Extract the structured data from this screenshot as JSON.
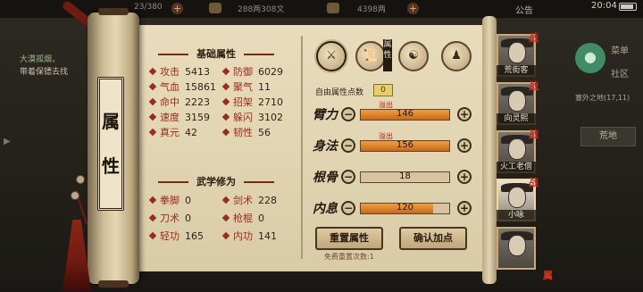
{
  "topbar": {
    "stamina": "23/380",
    "currency": "288两308文",
    "gold": "4398两",
    "notice": "公告",
    "time": "20:04"
  },
  "quest": {
    "line1": "大漠孤烟，",
    "line2": "带着保镖去找"
  },
  "side_right": {
    "menu": "菜单",
    "community": "社区",
    "location": "塞外之地(17,11)",
    "area": "荒地"
  },
  "scroll": {
    "title": "属性"
  },
  "base_attrs": {
    "title": "基础属性",
    "items": [
      {
        "label": "攻击",
        "value": "5413"
      },
      {
        "label": "防御",
        "value": "6029"
      },
      {
        "label": "气血",
        "value": "15861"
      },
      {
        "label": "聚气",
        "value": "11"
      },
      {
        "label": "命中",
        "value": "2223"
      },
      {
        "label": "招架",
        "value": "2710"
      },
      {
        "label": "速度",
        "value": "3159"
      },
      {
        "label": "躲闪",
        "value": "3102"
      },
      {
        "label": "真元",
        "value": "42"
      },
      {
        "label": "韧性",
        "value": "56"
      }
    ]
  },
  "martial_attrs": {
    "title": "武学修为",
    "items": [
      {
        "label": "拳脚",
        "value": "0"
      },
      {
        "label": "剑术",
        "value": "228"
      },
      {
        "label": "刀术",
        "value": "0"
      },
      {
        "label": "枪棍",
        "value": "0"
      },
      {
        "label": "轻功",
        "value": "165"
      },
      {
        "label": "内功",
        "value": "141"
      }
    ]
  },
  "tabs": {
    "active_mark": "属性"
  },
  "free_points": {
    "label": "自由属性点数",
    "value": "0"
  },
  "allocations": [
    {
      "name": "臂力",
      "value": "146",
      "overflow": "溢出",
      "fill": 1.0
    },
    {
      "name": "身法",
      "value": "156",
      "overflow": "溢出",
      "fill": 1.0
    },
    {
      "name": "根骨",
      "value": "18",
      "overflow": "",
      "fill": 0.0
    },
    {
      "name": "内息",
      "value": "120",
      "overflow": "",
      "fill": 0.82
    }
  ],
  "buttons": {
    "reset": "重置属性",
    "confirm": "确认加点",
    "reset_count": "免费重置次数:1"
  },
  "party": [
    {
      "name": "荒街客",
      "badge": "战"
    },
    {
      "name": "向灵熙",
      "badge": "战"
    },
    {
      "name": "火工老僧",
      "badge": "战"
    },
    {
      "name": "小咏",
      "badge": "战"
    },
    {
      "name": "",
      "badge": ""
    }
  ],
  "colors": {
    "accent_red": "#9b2b1c",
    "bar_fill": "#e08a2c",
    "paper": "#e4d7b5"
  }
}
